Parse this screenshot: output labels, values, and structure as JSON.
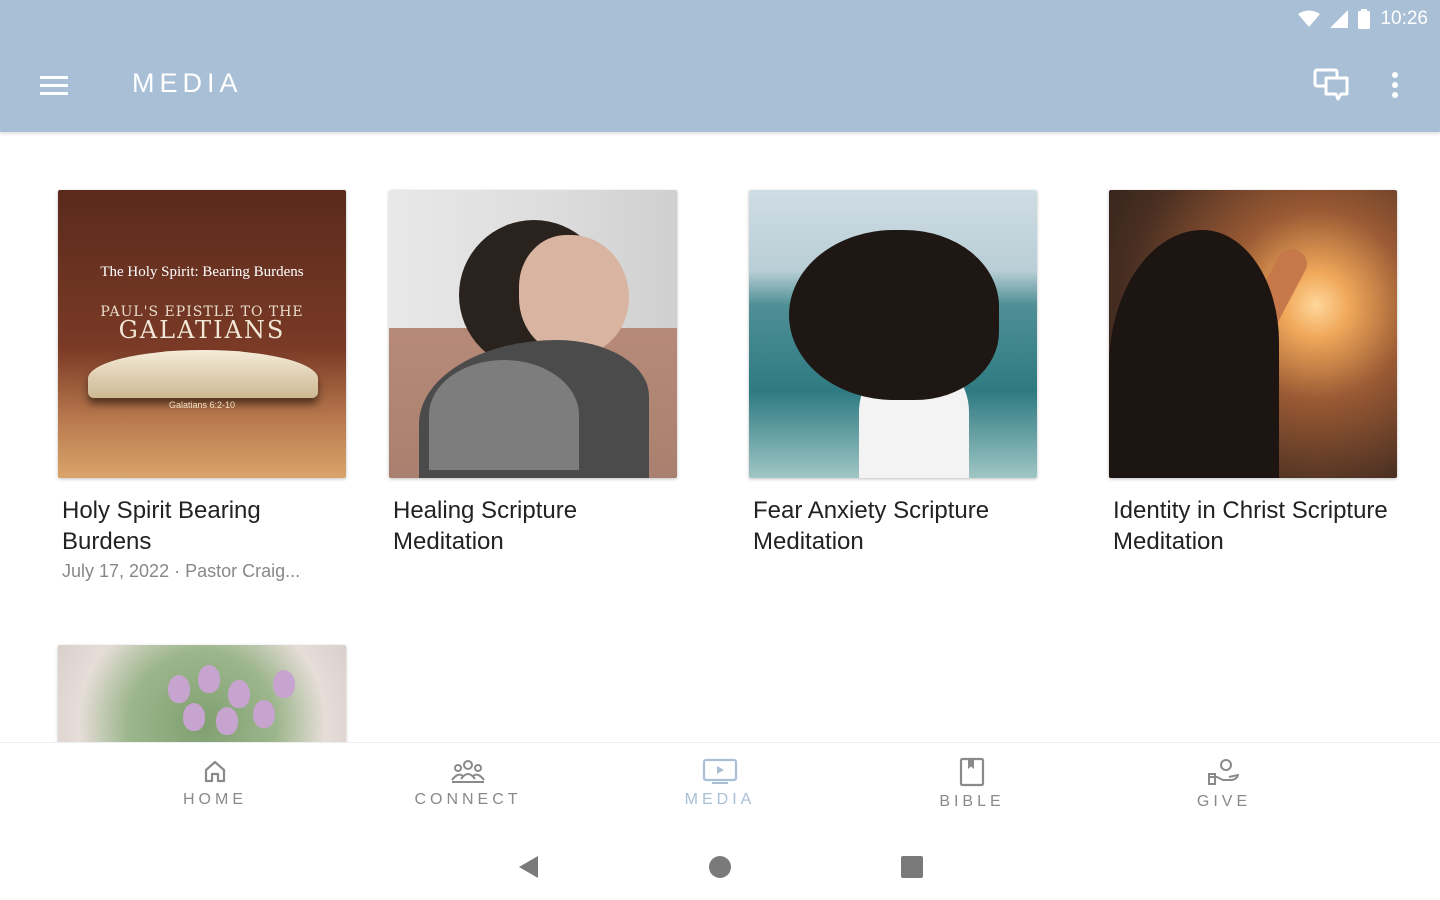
{
  "status_bar": {
    "time": "10:26"
  },
  "app_bar": {
    "title": "MEDIA",
    "icons": [
      "menu-icon",
      "chat-icon",
      "more-vert-icon"
    ]
  },
  "thumb1_text": {
    "line1": "The Holy Spirit: Bearing Burdens",
    "line2": "PAUL'S EPISTLE TO THE",
    "line3": "GALATIANS",
    "verse": "Galatians 6:2-10"
  },
  "media_items": [
    {
      "title": "Holy Spirit Bearing Burdens",
      "subtitle": "July 17, 2022 · Pastor Craig..."
    },
    {
      "title": "Healing Scripture Meditation",
      "subtitle": ""
    },
    {
      "title": "Fear Anxiety Scripture Meditation",
      "subtitle": ""
    },
    {
      "title": "Identity in Christ Scripture Meditation",
      "subtitle": ""
    }
  ],
  "bottom_nav": {
    "items": [
      {
        "label": "HOME",
        "icon": "home-icon"
      },
      {
        "label": "CONNECT",
        "icon": "group-icon"
      },
      {
        "label": "MEDIA",
        "icon": "media-icon"
      },
      {
        "label": "BIBLE",
        "icon": "book-icon"
      },
      {
        "label": "GIVE",
        "icon": "give-icon"
      }
    ],
    "active": "MEDIA"
  },
  "colors": {
    "accent": "#a8bfd6",
    "text": "#222222",
    "muted": "#888888"
  }
}
